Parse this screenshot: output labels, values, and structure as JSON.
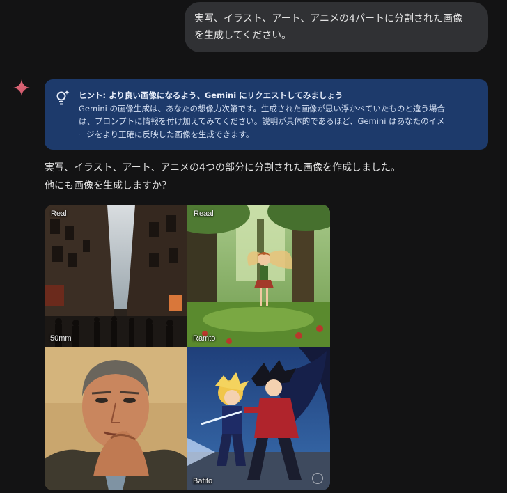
{
  "user_message": {
    "line1": "実写、イラスト、アート、アニメの4パートに分割された画像",
    "line2": "を生成してください。"
  },
  "hint": {
    "title": "ヒント: より良い画像になるよう、Gemini にリクエストしてみましょう",
    "line1": "Gemini の画像生成は、あなたの想像力次第です。生成された画像が思い浮かべていたものと違う場合",
    "line2": "は、プロンプトに情報を付け加えてみてください。説明が具体的であるほど、Gemini はあなたのイメ",
    "line3": "ージをより正確に反映した画像を生成できます。"
  },
  "response": {
    "line1": "実写、イラスト、アート、アニメの4つの部分に分割された画像を作成しました。",
    "line2": "他にも画像を生成しますか？"
  },
  "images": {
    "photo": {
      "top_label": "Real",
      "bottom_label": "50mm"
    },
    "illustration": {
      "top_label": "Reaal",
      "bottom_label": "Ramto"
    },
    "art": {},
    "anime": {
      "bottom_label": "Bafito"
    }
  },
  "icons": {
    "assistant": "gemini-sparkle-icon",
    "hint": "lightbulb-sparkle-icon"
  },
  "colors": {
    "background": "#131314",
    "user_bubble": "#303134",
    "hint_background": "#1d3a6b",
    "gemini_accent": "#d96570"
  }
}
